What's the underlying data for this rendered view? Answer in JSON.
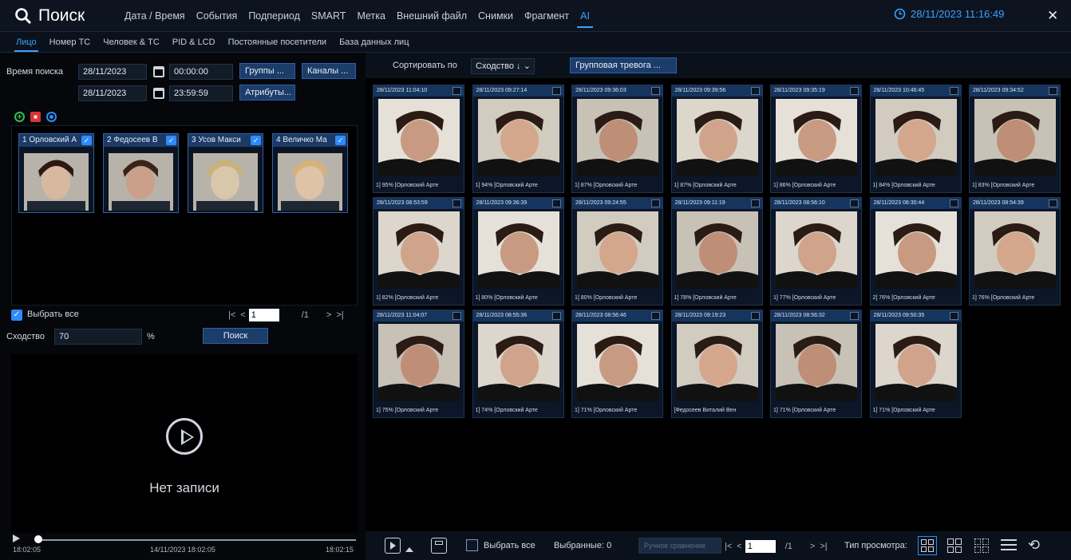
{
  "app": {
    "title": "Поиск",
    "datetime": "28/11/2023 11:16:49"
  },
  "menu": [
    "Дата / Время",
    "События",
    "Подпериод",
    "SMART",
    "Метка",
    "Внешний файл",
    "Снимки",
    "Фрагмент",
    "AI"
  ],
  "menu_active": "AI",
  "subtabs": [
    "Лицо",
    "Номер ТС",
    "Человек & ТС",
    "PID & LCD",
    "Постоянные посетители",
    "База данных лиц"
  ],
  "subtab_active": "Лицо",
  "search": {
    "time_label": "Время поиска",
    "start_date": "28/11/2023",
    "start_time": "00:00:00",
    "end_date": "28/11/2023",
    "end_time": "23:59:59",
    "groups_btn": "Группы ...",
    "channels_btn": "Каналы ...",
    "attributes_btn": "Атрибуты...",
    "library": [
      "1 Орловский А",
      "2 Федосеев В",
      "3 Усов Макси",
      "4 Величко Ма"
    ],
    "select_all": "Выбрать все",
    "page_current": "1",
    "page_total": "/1",
    "similarity_label": "Сходство",
    "similarity_value": "70",
    "percent": "%",
    "search_btn": "Поиск"
  },
  "player": {
    "no_record": "Нет записи",
    "time_left": "18:02:05",
    "time_center": "14/11/2023 18:02:05",
    "time_right": "18:02:15"
  },
  "results_toolbar": {
    "sort_label": "Сортировать по",
    "sort_value": "Сходство ↓",
    "group_alarm": "Групповая тревога ..."
  },
  "results": [
    {
      "time": "28/11/2023 11:04:10",
      "caption": "1] 95% [Орловский Арте"
    },
    {
      "time": "28/11/2023 09:27:14",
      "caption": "1] 94% [Орловский Арте"
    },
    {
      "time": "28/11/2023 09:36:03",
      "caption": "1] 87% [Орловский Арте"
    },
    {
      "time": "28/11/2023 09:39:56",
      "caption": "1] 87% [Орловский Арте"
    },
    {
      "time": "28/11/2023 09:35:19",
      "caption": "1] 86% [Орловский Арте"
    },
    {
      "time": "28/11/2023 10:46:45",
      "caption": "1] 84% [Орловский Арте"
    },
    {
      "time": "28/11/2023 09:34:52",
      "caption": "1] 83% [Орловский Арте"
    },
    {
      "time": "28/11/2023 08:53:59",
      "caption": "1] 82% [Орловский Арте"
    },
    {
      "time": "28/11/2023 09:36:39",
      "caption": "1] 80% [Орловский Арте"
    },
    {
      "time": "28/11/2023 09:24:55",
      "caption": "1] 80% [Орловский Арте"
    },
    {
      "time": "28/11/2023 09:11:19",
      "caption": "1] 78% [Орловский Арте"
    },
    {
      "time": "28/11/2023 08:56:10",
      "caption": "1] 77% [Орловский Арте"
    },
    {
      "time": "28/11/2023 08:30:44",
      "caption": "2] 76% [Орловский Арте"
    },
    {
      "time": "28/11/2023 08:54:39",
      "caption": "1] 76% [Орловский Арте"
    },
    {
      "time": "28/11/2023 11:04:07",
      "caption": "1] 75% [Орловский Арте"
    },
    {
      "time": "28/11/2023 08:55:36",
      "caption": "1] 74% [Орловский Арте"
    },
    {
      "time": "28/11/2023 08:56:46",
      "caption": "1] 71% [Орловский Арте"
    },
    {
      "time": "28/11/2023 09:19:23",
      "caption": "[Федосеев Виталий Вен"
    },
    {
      "time": "28/11/2023 08:56:32",
      "caption": "1] 71% [Орловский Арте"
    },
    {
      "time": "28/11/2023 09:50:35",
      "caption": "1] 71% [Орловский Арте"
    }
  ],
  "bottom": {
    "select_all": "Выбрать все",
    "selected": "Выбранные: 0",
    "manual_compare": "Ручное сравнение",
    "page_current": "1",
    "page_total": "/1",
    "view_type": "Тип просмотра:"
  },
  "colors": {
    "accent": "#3fa0ff",
    "card_header": "#16355e",
    "button": "#1c3c6a"
  }
}
